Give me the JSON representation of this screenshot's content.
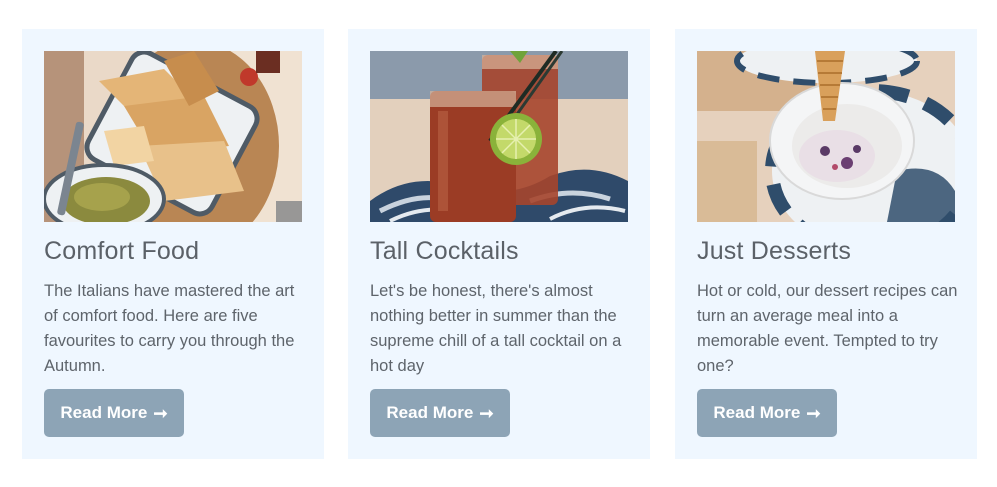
{
  "cards": [
    {
      "title": "Comfort Food",
      "description": "The Italians have mastered the art of comfort food. Here are five favourites to carry you through the Autumn.",
      "button_label": "Read More",
      "button_icon": "arrow-right-icon"
    },
    {
      "title": "Tall Cocktails",
      "description": "Let's be honest, there's almost nothing better in summer than the supreme chill of a tall cocktail on a hot day",
      "button_label": "Read More",
      "button_icon": "arrow-right-icon"
    },
    {
      "title": "Just Desserts",
      "description": "Hot or cold, our dessert recipes can turn an average meal into a memorable event. Tempted to try one?",
      "button_label": "Read More",
      "button_icon": "arrow-right-icon"
    }
  ],
  "colors": {
    "card_background": "#eff7ff",
    "button_background": "#8da4b6",
    "text": "#5e646b"
  }
}
